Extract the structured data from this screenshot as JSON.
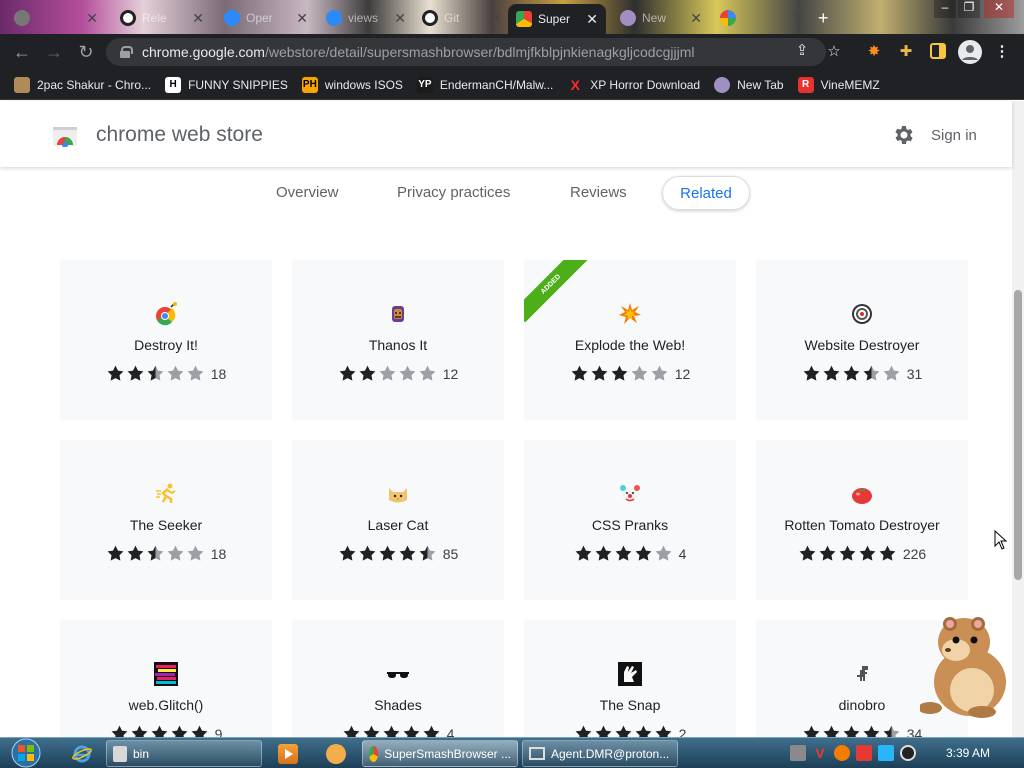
{
  "browser": {
    "tabs": [
      {
        "label": "",
        "favicon_color": "#888888"
      },
      {
        "label": "Rele",
        "favicon_color": "#ffffff"
      },
      {
        "label": "Oper",
        "favicon_color": "#2b8af7"
      },
      {
        "label": "views",
        "favicon_color": "#2b8af7"
      },
      {
        "label": "Git",
        "favicon_color": "#ffffff"
      },
      {
        "label": "Super",
        "favicon_color": "#e94235",
        "active": true
      },
      {
        "label": "New",
        "favicon_color": "#a08fc0"
      },
      {
        "label": "",
        "favicon_color": "#4285f4"
      }
    ],
    "new_tab_label": "+",
    "window_controls": [
      "–",
      "❐",
      "✕"
    ],
    "url_host": "chrome.google.com",
    "url_path": "/webstore/detail/supersmashbrowser/bdlmjfkblpjnkienagkgljcodcgjjjml",
    "bookmarks": [
      {
        "label": "2pac Shakur - Chro...",
        "icon": "2pac-icon",
        "icon_color": "#b08b5a"
      },
      {
        "label": "FUNNY SNIPPIES",
        "icon": "H",
        "icon_color": "#ffffff"
      },
      {
        "label": "windows ISOS",
        "icon": "PH",
        "icon_color": "#f7a400"
      },
      {
        "label": "EndermanCH/Malw...",
        "icon": "YP",
        "icon_color": "#1b1b1b"
      },
      {
        "label": "XP Horror Download",
        "icon": "X",
        "icon_color": "#ff2b2b"
      },
      {
        "label": "New Tab",
        "icon": "newtab-icon",
        "icon_color": "#a08fc0"
      },
      {
        "label": "VineMEMZ",
        "icon": "R",
        "icon_color": "#e8322e"
      }
    ]
  },
  "store": {
    "title": "chrome web store",
    "sign_in": "Sign in",
    "nav": [
      "Overview",
      "Privacy practices",
      "Reviews",
      "Related"
    ],
    "active_nav": "Related",
    "added_label": "ADDED",
    "items": [
      {
        "name": "Destroy It!",
        "rating": 2.5,
        "count": "18",
        "icon": "chrome-bomb-icon"
      },
      {
        "name": "Thanos It",
        "rating": 2,
        "count": "12",
        "icon": "thanos-icon"
      },
      {
        "name": "Explode the Web!",
        "rating": 3,
        "count": "12",
        "icon": "explosion-icon",
        "added": true
      },
      {
        "name": "Website Destroyer",
        "rating": 3.5,
        "count": "31",
        "icon": "target-icon"
      },
      {
        "name": "The Seeker",
        "rating": 2.5,
        "count": "18",
        "icon": "runner-icon"
      },
      {
        "name": "Laser Cat",
        "rating": 4.5,
        "count": "85",
        "icon": "cat-icon"
      },
      {
        "name": "CSS Pranks",
        "rating": 4,
        "count": "4",
        "icon": "clown-icon"
      },
      {
        "name": "Rotten Tomato Destroyer",
        "rating": 5,
        "count": "226",
        "icon": "tomato-icon"
      },
      {
        "name": "web.Glitch()",
        "rating": 5,
        "count": "9",
        "icon": "glitch-icon"
      },
      {
        "name": "Shades",
        "rating": 5,
        "count": "4",
        "icon": "sunglasses-icon"
      },
      {
        "name": "The Snap",
        "rating": 5,
        "count": "2",
        "icon": "glove-icon"
      },
      {
        "name": "dinobro",
        "rating": 4.5,
        "count": "34",
        "icon": "dino-icon"
      }
    ]
  },
  "taskbar": {
    "windows": [
      {
        "label": "bin",
        "icon": "folder-icon"
      },
      {
        "label": "SuperSmashBrowser ...",
        "icon": "chrome-icon",
        "active": true
      },
      {
        "label": "Agent.DMR@proton...",
        "icon": "app-window-icon"
      }
    ],
    "clock": "3:39 AM"
  },
  "colors": {
    "accent": "#1a73e8",
    "star_filled": "#202124",
    "star_empty": "#9aa0a6",
    "added_ribbon": "#4caf1a"
  }
}
